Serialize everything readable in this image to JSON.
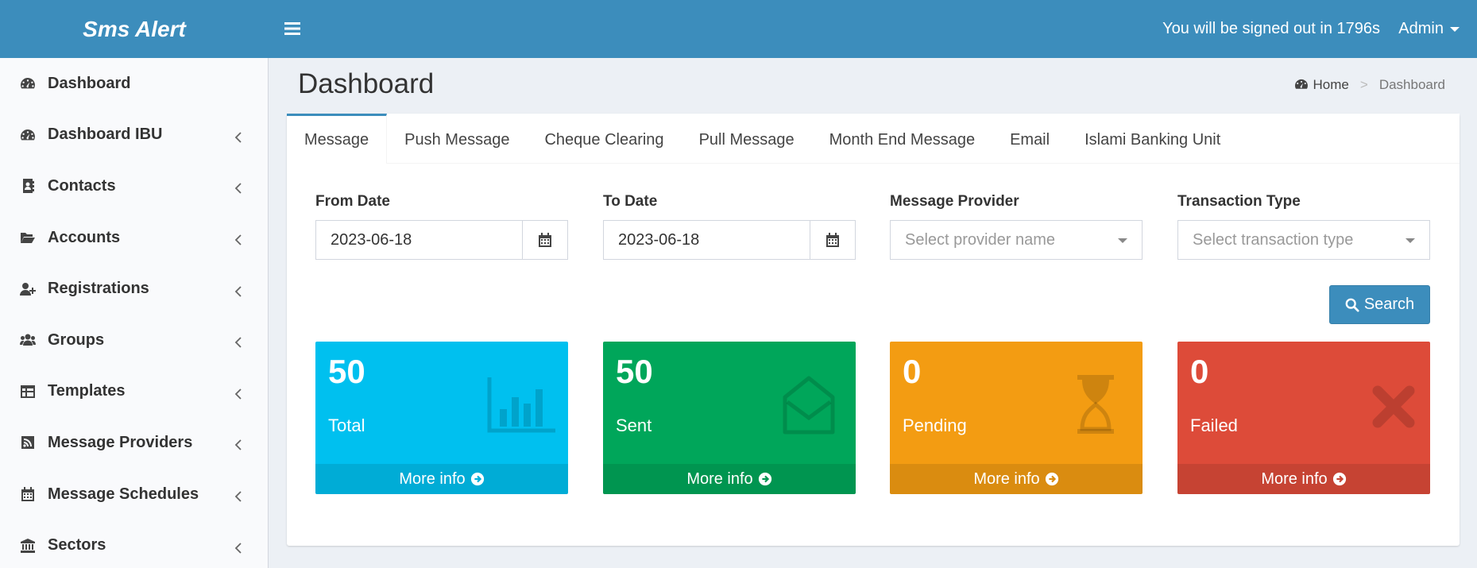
{
  "app": {
    "logo": "Sms Alert",
    "signout_text": "You will be signed out in 1796s",
    "user_menu": "Admin"
  },
  "sidebar": {
    "items": [
      {
        "label": "Dashboard",
        "icon": "dashboard-icon"
      },
      {
        "label": "Dashboard IBU",
        "icon": "dashboard-icon"
      },
      {
        "label": "Contacts",
        "icon": "address-book-icon"
      },
      {
        "label": "Accounts",
        "icon": "folder-open-icon"
      },
      {
        "label": "Registrations",
        "icon": "user-plus-icon"
      },
      {
        "label": "Groups",
        "icon": "users-icon"
      },
      {
        "label": "Templates",
        "icon": "table-icon"
      },
      {
        "label": "Message Providers",
        "icon": "rss-icon"
      },
      {
        "label": "Message Schedules",
        "icon": "calendar-icon"
      },
      {
        "label": "Sectors",
        "icon": "bank-icon"
      }
    ]
  },
  "page": {
    "title": "Dashboard",
    "breadcrumb": {
      "home": "Home",
      "separator": ">",
      "current": "Dashboard"
    }
  },
  "tabs": [
    {
      "label": "Message",
      "active": true
    },
    {
      "label": "Push Message",
      "active": false
    },
    {
      "label": "Cheque Clearing",
      "active": false
    },
    {
      "label": "Pull Message",
      "active": false
    },
    {
      "label": "Month End Message",
      "active": false
    },
    {
      "label": "Email",
      "active": false
    },
    {
      "label": "Islami Banking Unit",
      "active": false
    }
  ],
  "filters": {
    "from_date": {
      "label": "From Date",
      "value": "2023-06-18"
    },
    "to_date": {
      "label": "To Date",
      "value": "2023-06-18"
    },
    "provider": {
      "label": "Message Provider",
      "placeholder": "Select provider name"
    },
    "transaction": {
      "label": "Transaction Type",
      "placeholder": "Select transaction type"
    },
    "search_label": "Search"
  },
  "stats": [
    {
      "value": "50",
      "label": "Total",
      "more": "More info",
      "color": "#00c0ef",
      "icon": "bar-chart-icon"
    },
    {
      "value": "50",
      "label": "Sent",
      "more": "More info",
      "color": "#00a65a",
      "icon": "envelope-open-icon"
    },
    {
      "value": "0",
      "label": "Pending",
      "more": "More info",
      "color": "#f39c12",
      "icon": "hourglass-icon"
    },
    {
      "value": "0",
      "label": "Failed",
      "more": "More info",
      "color": "#dd4b39",
      "icon": "times-icon"
    }
  ],
  "colors": {
    "header": "#3c8dbc",
    "primary": "#3c8dbc"
  }
}
